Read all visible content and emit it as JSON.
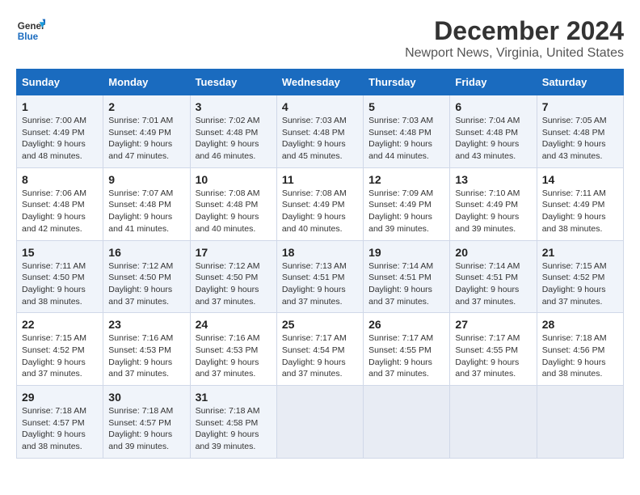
{
  "logo": {
    "line1": "General",
    "line2": "Blue"
  },
  "title": "December 2024",
  "subtitle": "Newport News, Virginia, United States",
  "days_of_week": [
    "Sunday",
    "Monday",
    "Tuesday",
    "Wednesday",
    "Thursday",
    "Friday",
    "Saturday"
  ],
  "weeks": [
    [
      {
        "day": "1",
        "sunrise": "Sunrise: 7:00 AM",
        "sunset": "Sunset: 4:49 PM",
        "daylight": "Daylight: 9 hours and 48 minutes."
      },
      {
        "day": "2",
        "sunrise": "Sunrise: 7:01 AM",
        "sunset": "Sunset: 4:49 PM",
        "daylight": "Daylight: 9 hours and 47 minutes."
      },
      {
        "day": "3",
        "sunrise": "Sunrise: 7:02 AM",
        "sunset": "Sunset: 4:48 PM",
        "daylight": "Daylight: 9 hours and 46 minutes."
      },
      {
        "day": "4",
        "sunrise": "Sunrise: 7:03 AM",
        "sunset": "Sunset: 4:48 PM",
        "daylight": "Daylight: 9 hours and 45 minutes."
      },
      {
        "day": "5",
        "sunrise": "Sunrise: 7:03 AM",
        "sunset": "Sunset: 4:48 PM",
        "daylight": "Daylight: 9 hours and 44 minutes."
      },
      {
        "day": "6",
        "sunrise": "Sunrise: 7:04 AM",
        "sunset": "Sunset: 4:48 PM",
        "daylight": "Daylight: 9 hours and 43 minutes."
      },
      {
        "day": "7",
        "sunrise": "Sunrise: 7:05 AM",
        "sunset": "Sunset: 4:48 PM",
        "daylight": "Daylight: 9 hours and 43 minutes."
      }
    ],
    [
      {
        "day": "8",
        "sunrise": "Sunrise: 7:06 AM",
        "sunset": "Sunset: 4:48 PM",
        "daylight": "Daylight: 9 hours and 42 minutes."
      },
      {
        "day": "9",
        "sunrise": "Sunrise: 7:07 AM",
        "sunset": "Sunset: 4:48 PM",
        "daylight": "Daylight: 9 hours and 41 minutes."
      },
      {
        "day": "10",
        "sunrise": "Sunrise: 7:08 AM",
        "sunset": "Sunset: 4:48 PM",
        "daylight": "Daylight: 9 hours and 40 minutes."
      },
      {
        "day": "11",
        "sunrise": "Sunrise: 7:08 AM",
        "sunset": "Sunset: 4:49 PM",
        "daylight": "Daylight: 9 hours and 40 minutes."
      },
      {
        "day": "12",
        "sunrise": "Sunrise: 7:09 AM",
        "sunset": "Sunset: 4:49 PM",
        "daylight": "Daylight: 9 hours and 39 minutes."
      },
      {
        "day": "13",
        "sunrise": "Sunrise: 7:10 AM",
        "sunset": "Sunset: 4:49 PM",
        "daylight": "Daylight: 9 hours and 39 minutes."
      },
      {
        "day": "14",
        "sunrise": "Sunrise: 7:11 AM",
        "sunset": "Sunset: 4:49 PM",
        "daylight": "Daylight: 9 hours and 38 minutes."
      }
    ],
    [
      {
        "day": "15",
        "sunrise": "Sunrise: 7:11 AM",
        "sunset": "Sunset: 4:50 PM",
        "daylight": "Daylight: 9 hours and 38 minutes."
      },
      {
        "day": "16",
        "sunrise": "Sunrise: 7:12 AM",
        "sunset": "Sunset: 4:50 PM",
        "daylight": "Daylight: 9 hours and 37 minutes."
      },
      {
        "day": "17",
        "sunrise": "Sunrise: 7:12 AM",
        "sunset": "Sunset: 4:50 PM",
        "daylight": "Daylight: 9 hours and 37 minutes."
      },
      {
        "day": "18",
        "sunrise": "Sunrise: 7:13 AM",
        "sunset": "Sunset: 4:51 PM",
        "daylight": "Daylight: 9 hours and 37 minutes."
      },
      {
        "day": "19",
        "sunrise": "Sunrise: 7:14 AM",
        "sunset": "Sunset: 4:51 PM",
        "daylight": "Daylight: 9 hours and 37 minutes."
      },
      {
        "day": "20",
        "sunrise": "Sunrise: 7:14 AM",
        "sunset": "Sunset: 4:51 PM",
        "daylight": "Daylight: 9 hours and 37 minutes."
      },
      {
        "day": "21",
        "sunrise": "Sunrise: 7:15 AM",
        "sunset": "Sunset: 4:52 PM",
        "daylight": "Daylight: 9 hours and 37 minutes."
      }
    ],
    [
      {
        "day": "22",
        "sunrise": "Sunrise: 7:15 AM",
        "sunset": "Sunset: 4:52 PM",
        "daylight": "Daylight: 9 hours and 37 minutes."
      },
      {
        "day": "23",
        "sunrise": "Sunrise: 7:16 AM",
        "sunset": "Sunset: 4:53 PM",
        "daylight": "Daylight: 9 hours and 37 minutes."
      },
      {
        "day": "24",
        "sunrise": "Sunrise: 7:16 AM",
        "sunset": "Sunset: 4:53 PM",
        "daylight": "Daylight: 9 hours and 37 minutes."
      },
      {
        "day": "25",
        "sunrise": "Sunrise: 7:17 AM",
        "sunset": "Sunset: 4:54 PM",
        "daylight": "Daylight: 9 hours and 37 minutes."
      },
      {
        "day": "26",
        "sunrise": "Sunrise: 7:17 AM",
        "sunset": "Sunset: 4:55 PM",
        "daylight": "Daylight: 9 hours and 37 minutes."
      },
      {
        "day": "27",
        "sunrise": "Sunrise: 7:17 AM",
        "sunset": "Sunset: 4:55 PM",
        "daylight": "Daylight: 9 hours and 37 minutes."
      },
      {
        "day": "28",
        "sunrise": "Sunrise: 7:18 AM",
        "sunset": "Sunset: 4:56 PM",
        "daylight": "Daylight: 9 hours and 38 minutes."
      }
    ],
    [
      {
        "day": "29",
        "sunrise": "Sunrise: 7:18 AM",
        "sunset": "Sunset: 4:57 PM",
        "daylight": "Daylight: 9 hours and 38 minutes."
      },
      {
        "day": "30",
        "sunrise": "Sunrise: 7:18 AM",
        "sunset": "Sunset: 4:57 PM",
        "daylight": "Daylight: 9 hours and 39 minutes."
      },
      {
        "day": "31",
        "sunrise": "Sunrise: 7:18 AM",
        "sunset": "Sunset: 4:58 PM",
        "daylight": "Daylight: 9 hours and 39 minutes."
      },
      null,
      null,
      null,
      null
    ]
  ]
}
